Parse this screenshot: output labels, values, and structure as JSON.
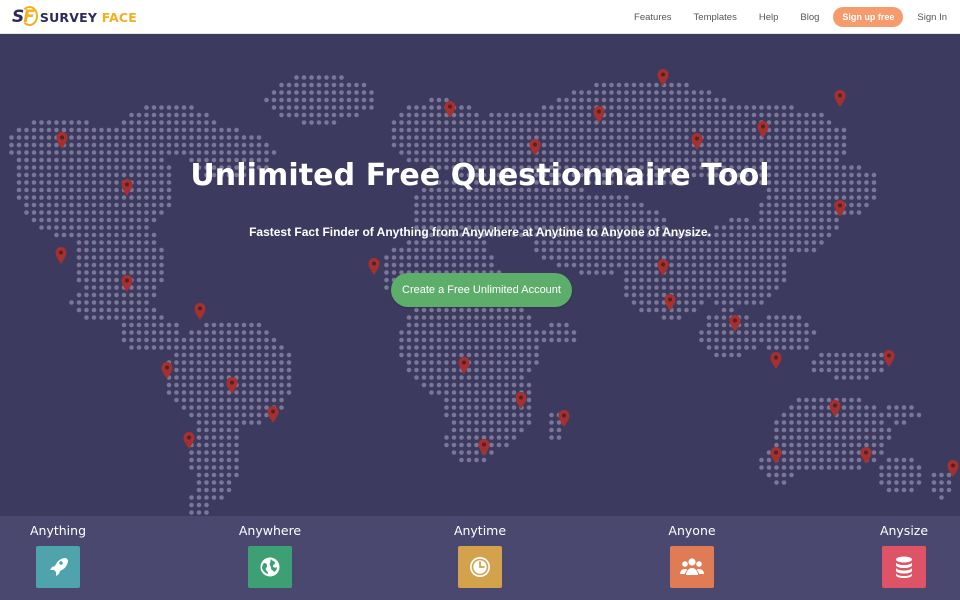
{
  "nav": {
    "logo_mark_s": "S",
    "logo_mark_f": "F",
    "logo_word_1": "SURVEY",
    "logo_word_2": "FACE",
    "items": [
      "Features",
      "Templates",
      "Help",
      "Blog"
    ],
    "signup_label": "Sign up free",
    "signin_label": "Sign In"
  },
  "hero": {
    "title": "Unlimited Free Questionnaire Tool",
    "subtitle": "Fastest Fact Finder of Anything from Anywhere at Anytime to Anyone of Anysize.",
    "cta_label": "Create a Free Unlimited Account"
  },
  "features": [
    {
      "label": "Anything",
      "icon": "rocket-icon",
      "color": "#4fa3ad"
    },
    {
      "label": "Anywhere",
      "icon": "globe-icon",
      "color": "#3d9f74"
    },
    {
      "label": "Anytime",
      "icon": "clock-icon",
      "color": "#d4a24c"
    },
    {
      "label": "Anyone",
      "icon": "people-icon",
      "color": "#e07c55"
    },
    {
      "label": "Anysize",
      "icon": "database-icon",
      "color": "#de5466"
    }
  ],
  "colors": {
    "background": "#3d3a60",
    "dot": "#7a7896",
    "pin": "#a4312f",
    "cta": "#5cae6a",
    "signup": "#f59b6c"
  }
}
